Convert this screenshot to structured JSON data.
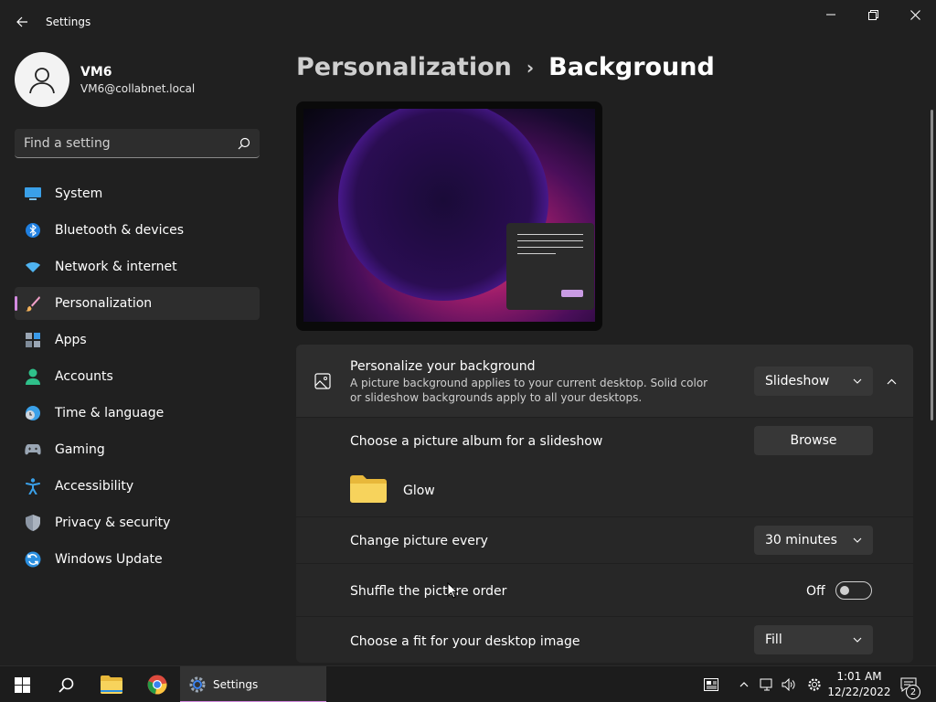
{
  "window": {
    "title": "Settings",
    "minimize_glyph": "—",
    "maximize_glyph": "❐",
    "close_glyph": "✕"
  },
  "profile": {
    "name": "VM6",
    "email": "VM6@collabnet.local"
  },
  "search": {
    "placeholder": "Find a setting"
  },
  "sidebar": {
    "items": [
      {
        "label": "System",
        "icon": "system-icon"
      },
      {
        "label": "Bluetooth & devices",
        "icon": "bluetooth-icon"
      },
      {
        "label": "Network & internet",
        "icon": "wifi-icon"
      },
      {
        "label": "Personalization",
        "icon": "brush-icon",
        "active": true
      },
      {
        "label": "Apps",
        "icon": "apps-icon"
      },
      {
        "label": "Accounts",
        "icon": "accounts-icon"
      },
      {
        "label": "Time & language",
        "icon": "clock-globe-icon"
      },
      {
        "label": "Gaming",
        "icon": "gamepad-icon"
      },
      {
        "label": "Accessibility",
        "icon": "accessibility-icon"
      },
      {
        "label": "Privacy & security",
        "icon": "shield-icon"
      },
      {
        "label": "Windows Update",
        "icon": "update-icon"
      }
    ]
  },
  "breadcrumb": {
    "parent": "Personalization",
    "separator": "›",
    "current": "Background"
  },
  "personalize": {
    "title": "Personalize your background",
    "description": "A picture background applies to your current desktop. Solid color or slideshow backgrounds apply to all your desktops.",
    "dropdown_value": "Slideshow"
  },
  "album": {
    "title": "Choose a picture album for a slideshow",
    "browse_label": "Browse",
    "folder_name": "Glow"
  },
  "interval": {
    "title": "Change picture every",
    "dropdown_value": "30 minutes"
  },
  "shuffle": {
    "title": "Shuffle the picture order",
    "state_label": "Off"
  },
  "fit": {
    "title": "Choose a fit for your desktop image",
    "dropdown_value": "Fill"
  },
  "taskbar": {
    "settings_label": "Settings",
    "time": "1:01 AM",
    "date": "12/22/2022",
    "notification_count": "2"
  },
  "colors": {
    "accent": "#d38ae0",
    "background": "#202020",
    "card": "#2b2b2b"
  }
}
